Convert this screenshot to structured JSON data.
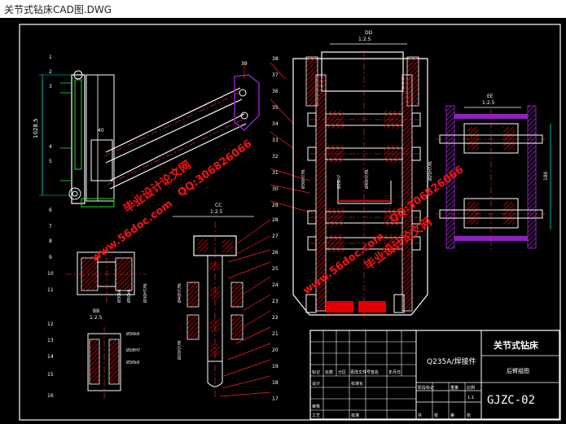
{
  "window": {
    "title": "关节式钻床CAD图.DWG"
  },
  "drawing": {
    "views": {
      "dd": {
        "label": "DD",
        "scale": "1:2.5"
      },
      "ee": {
        "label": "EE",
        "scale": "1:2.5"
      },
      "cc": {
        "label": "CC",
        "scale": "1:2.5"
      },
      "bb": {
        "label": "BB",
        "scale": "1:2.5"
      }
    },
    "dimensions": {
      "left_height": "1028.5",
      "ee_width": "180",
      "d1": "Ø30H7/f6",
      "d2": "Ø28H7",
      "d3": "Ø20H7/f6",
      "d4": "Ø40H7/f6",
      "d5": "Ø30k6",
      "d6": "Ø50k6",
      "d7": "Ø25H7/f6",
      "d8": "Ø30k6"
    },
    "balloons": [
      "1",
      "2",
      "3",
      "4",
      "5",
      "6",
      "7",
      "8",
      "9",
      "10",
      "11",
      "12",
      "13",
      "14",
      "15",
      "16",
      "17",
      "18",
      "19",
      "20",
      "21",
      "22",
      "23",
      "24",
      "25",
      "26",
      "27",
      "28",
      "29",
      "30",
      "31",
      "32",
      "33",
      "34",
      "35",
      "36",
      "37",
      "38",
      "39",
      "40"
    ],
    "watermarks": {
      "site": "www.56doc.com",
      "name": "毕业设计论文网",
      "qq": "QQ:306826066"
    },
    "title_block": {
      "material": "Q235A/焊接件",
      "name": "关节式钻床",
      "subtitle": "后臂组图",
      "code": "GJZC-02",
      "scale": "1:1",
      "labels": [
        "标记",
        "处数",
        "分区",
        "更改文件号",
        "签名",
        "年月日",
        "设计",
        "标准化",
        "审核",
        "工艺",
        "批准",
        "阶段标记",
        "重量",
        "比例",
        "共",
        "张",
        "第",
        "张"
      ]
    }
  },
  "colors": {
    "background": "#000000",
    "frame": "#ffffff",
    "outline": "#ffffff",
    "hatch": "#e00000",
    "centerline": "#ff3030",
    "dimension": "#00e0e0",
    "leader": "#ff2020",
    "accent_green": "#20e020",
    "purple": "#9020c0",
    "watermark": "#ff1010"
  }
}
